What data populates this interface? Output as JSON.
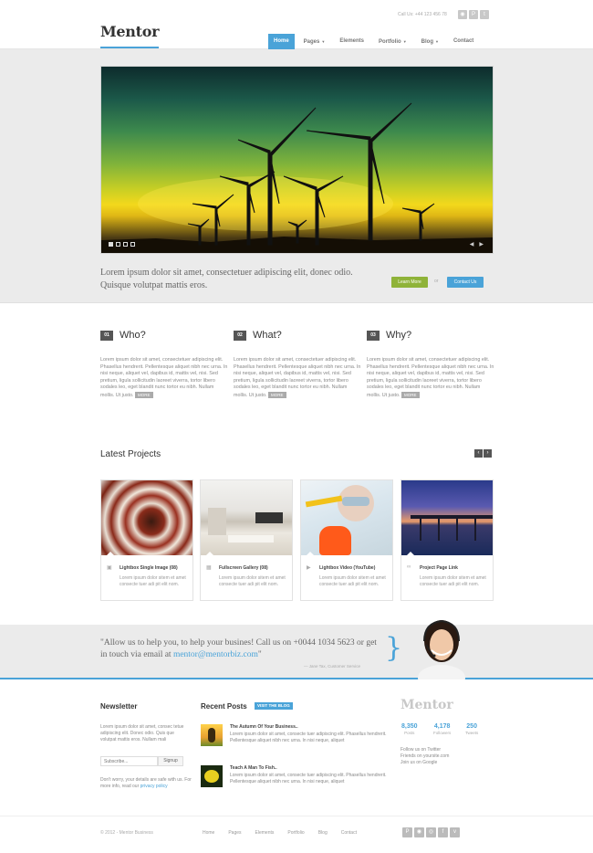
{
  "header": {
    "logo": "Mentor",
    "callus": "Call Us: +44 123 456 78",
    "social": [
      "rss-icon",
      "pinterest-icon",
      "twitter-icon"
    ],
    "nav": [
      {
        "label": "Home",
        "active": true,
        "dropdown": false
      },
      {
        "label": "Pages",
        "active": false,
        "dropdown": true
      },
      {
        "label": "Elements",
        "active": false,
        "dropdown": false
      },
      {
        "label": "Portfolio",
        "active": false,
        "dropdown": true
      },
      {
        "label": "Blog",
        "active": false,
        "dropdown": true
      },
      {
        "label": "Contact",
        "active": false,
        "dropdown": false
      }
    ]
  },
  "hero": {
    "slider_dots": 4,
    "active_dot": 0,
    "tagline": "Lorem ipsum dolor sit amet, consectetuer adipiscing elit, donec odio. Quisque volutpat mattis eros.",
    "learn_more": "Learn More",
    "or": "or",
    "contact_us": "Contact Us"
  },
  "features": [
    {
      "num": "01",
      "title": "Who?",
      "text": "Lorem ipsum dolor sit amet, consectetuer adipiscing elit. Phasellus hendrerit. Pellentesque aliquet nibh nec urna. In nisi neque, aliquet vel, dapibus id, mattis vel, nisi. Sed pretium, ligula sollicitudin laoreet viverra, tortor libero sodales leo, eget blandit nunc tortor eu nibh. Nullam mollis. Ut justo.",
      "more": "MORE"
    },
    {
      "num": "02",
      "title": "What?",
      "text": "Lorem ipsum dolor sit amet, consectetuer adipiscing elit. Phasellus hendrerit. Pellentesque aliquet nibh nec urna. In nisi neque, aliquet vel, dapibus id, mattis vel, nisi. Sed pretium, ligula sollicitudin laoreet viverra, tortor libero sodales leo, eget blandit nunc tortor eu nibh. Nullam mollis. Ut justo.",
      "more": "MORE"
    },
    {
      "num": "03",
      "title": "Why?",
      "text": "Lorem ipsum dolor sit amet, consectetuer adipiscing elit. Phasellus hendrerit. Pellentesque aliquet nibh nec urna. In nisi neque, aliquet vel, dapibus id, mattis vel, nisi. Sed pretium, ligula sollicitudin laoreet viverra, tortor libero sodales leo, eget blandit nunc tortor eu nibh. Nullam mollis. Ut justo.",
      "more": "MORE"
    }
  ],
  "projects": {
    "title": "Latest Projects",
    "items": [
      {
        "name": "Lightbox Single Image (08)",
        "icon": "image-icon",
        "text": "Lorem ipsum dolor sitem et amet consecte tuer adi pit elit nom."
      },
      {
        "name": "Fullscreen Gallery (08)",
        "icon": "gallery-icon",
        "text": "Lorem ipsum dolor sitem et amet consecte tuer adi pit elit nom."
      },
      {
        "name": "Lightbox Video (YouTube)",
        "icon": "video-icon",
        "text": "Lorem ipsum dolor sitem et amet consecte tuer adi pit elit nom."
      },
      {
        "name": "Project Page Link",
        "icon": "link-icon",
        "text": "Lorem ipsum dolor sitem et amet consecte tuer adi pit elit nom."
      }
    ]
  },
  "quote": {
    "text_before": "\"Allow us to help you, to help your busines! Call us on +0044 1034 5623 or get in touch via email at ",
    "email": "mentor@mentorbiz.com",
    "text_after": "\"",
    "author": "— Jane Tax, Customer Service"
  },
  "newsletter": {
    "title": "Newsletter",
    "text": "Lorem ipsum dolor sit amet, consec tetue adipiscing elit. Donec odio. Quis que volutpat mattis eros. Nullam mali",
    "placeholder": "Subscribe...",
    "button": "Signup",
    "note": "Don't worry, your details are safe with us. For more info, read our ",
    "note_link": "privacy policy"
  },
  "recent_posts": {
    "title": "Recent Posts",
    "badge": "VISIT THE BLOG",
    "items": [
      {
        "title": "The Autumn Of Your Business..",
        "text": "Lorem ipsum dolor sit amet, consecte tuer adipiscing elit. Phasellus hendrerit. Pellentesque aliquet nibh nec urna. In nisi neque, aliquet"
      },
      {
        "title": "Teach A Man To Fish..",
        "text": "Lorem ipsum dolor sit amet, consecte tuer adipiscing elit. Phasellus hendrerit. Pellentesque aliquet nibh nec urna. In nisi neque, aliquet"
      }
    ]
  },
  "about": {
    "logo": "Mentor",
    "stats": [
      {
        "value": "8,350",
        "label": "Posts"
      },
      {
        "value": "4,178",
        "label": "Followers"
      },
      {
        "value": "250",
        "label": "Tweets"
      }
    ],
    "follow": [
      "Follow us on Twitter",
      "Friends on yoursite.com",
      "Join us on Google"
    ]
  },
  "footer": {
    "copyright": "© 2012 - Mentor Business",
    "nav": [
      "Home",
      "Pages",
      "Elements",
      "Portfolio",
      "Blog",
      "Contact"
    ],
    "social": [
      "pinterest-icon",
      "rss-icon",
      "dribbble-icon",
      "facebook-icon",
      "vimeo-icon"
    ]
  },
  "colors": {
    "accent": "#4aa3d8",
    "green": "#8fb339",
    "dark": "#333333"
  }
}
